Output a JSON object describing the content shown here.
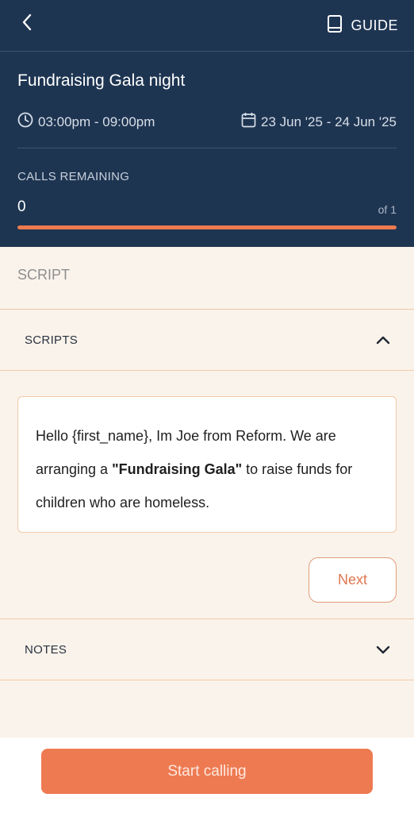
{
  "topbar": {
    "guide_label": "GUIDE",
    "icons": [
      "back-chevron-icon",
      "book-icon"
    ]
  },
  "event": {
    "title": "Fundraising Gala night",
    "time": "03:00pm - 09:00pm",
    "dates": "23 Jun '25 - 24 Jun '25",
    "icons": [
      "clock-icon",
      "calendar-icon"
    ]
  },
  "calls": {
    "label": "CALLS REMAINING",
    "remaining": "0",
    "total_label": "of 1",
    "progress_fraction": 1.0
  },
  "script_section": {
    "label": "SCRIPT",
    "accordion_title": "SCRIPTS",
    "expanded": true,
    "text_before": "Hello {first_name}, Im Joe from Reform. We are arranging a ",
    "text_bold": "\"Fundraising Gala\"",
    "text_after": " to raise funds for children who are homeless.",
    "next_label": "Next"
  },
  "notes_section": {
    "accordion_title": "NOTES",
    "expanded": false
  },
  "footer": {
    "start_label": "Start calling"
  },
  "colors": {
    "header_bg": "#1e3552",
    "accent": "#ee7a52",
    "page_bg": "#faf3eb",
    "border": "#f2c9a6"
  }
}
